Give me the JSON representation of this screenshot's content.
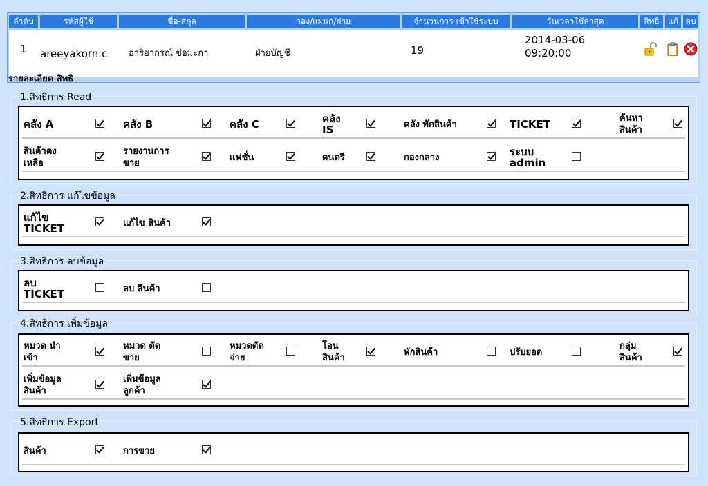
{
  "user_table": {
    "headers": [
      "ลำดับ",
      "รหัสผู้ใช้",
      "ชื่อ-สกุล",
      "กอง/แผนก/ฝ่าย",
      "จำนวนการ เข้าใช้ระบบ",
      "วันเวลาใช้ล่าสุด",
      "สิทธิ",
      "แก้",
      "ลบ"
    ],
    "row": {
      "index": "1",
      "username": "areeyakorn.c",
      "fullname": "อาริยากรณ์ ช่อมะกา",
      "department": "ฝ่ายบัญชี",
      "login_count": "19",
      "last_used": "2014-03-06\n09:20:00"
    },
    "icons": [
      "unlock-icon",
      "clipboard-icon",
      "delete-icon"
    ]
  },
  "detail_title": "รายละเอียด สิทธิ",
  "sections": [
    {
      "title": "1.สิทธิการ Read",
      "rows": [
        [
          {
            "label": "คลัง A",
            "checked": true
          },
          {
            "label": "คลัง B",
            "checked": true
          },
          {
            "label": "คลัง C",
            "checked": true
          },
          {
            "label": "คลัง\nIS",
            "checked": true
          },
          {
            "label": "คลัง พักสินค้า",
            "checked": true
          },
          {
            "label": "TICKET",
            "checked": true
          },
          {
            "label": "ค้นหา\nสินค้า",
            "checked": true
          }
        ],
        [
          {
            "label": "สินค้าคง\nเหลือ",
            "checked": true
          },
          {
            "label": "รายงานการ\nขาย",
            "checked": true
          },
          {
            "label": "แฟชั่น",
            "checked": true
          },
          {
            "label": "ดนตรี",
            "checked": true
          },
          {
            "label": "กองกลาง",
            "checked": true
          },
          {
            "label": "ระบบ\nadmin",
            "checked": false
          }
        ]
      ]
    },
    {
      "title": "2.สิทธิการ แก้ไขข้อมูล",
      "rows": [
        [
          {
            "label": "แก้ไข\nTICKET",
            "checked": true
          },
          {
            "label": "แก้ไข สินค้า",
            "checked": true
          }
        ]
      ]
    },
    {
      "title": "3.สิทธิการ ลบข้อมูล",
      "rows": [
        [
          {
            "label": "ลบ\nTICKET",
            "checked": false
          },
          {
            "label": "ลบ สินค้า",
            "checked": false
          }
        ]
      ]
    },
    {
      "title": "4.สิทธิการ เพิ่มข้อมูล",
      "rows": [
        [
          {
            "label": "หมวด นำ\nเข้า",
            "checked": true
          },
          {
            "label": "หมวด ตัด\nขาย",
            "checked": false
          },
          {
            "label": "หมวดตัด\nจ่าย",
            "checked": false
          },
          {
            "label": "โอน\nสินค้า",
            "checked": true
          },
          {
            "label": "พักสินค้า",
            "checked": false
          },
          {
            "label": "ปรับยอด",
            "checked": false
          },
          {
            "label": "กลุ่ม\nสินค้า",
            "checked": true
          }
        ],
        [
          {
            "label": "เพิ่มข้อมูล\nสินค้า",
            "checked": true
          },
          {
            "label": "เพิ่มข้อมูล\nลูกค้า",
            "checked": true
          }
        ]
      ]
    },
    {
      "title": "5.สิทธิการ Export",
      "rows": [
        [
          {
            "label": "สินค้า",
            "checked": true
          },
          {
            "label": "การขาย",
            "checked": true
          }
        ]
      ]
    }
  ]
}
